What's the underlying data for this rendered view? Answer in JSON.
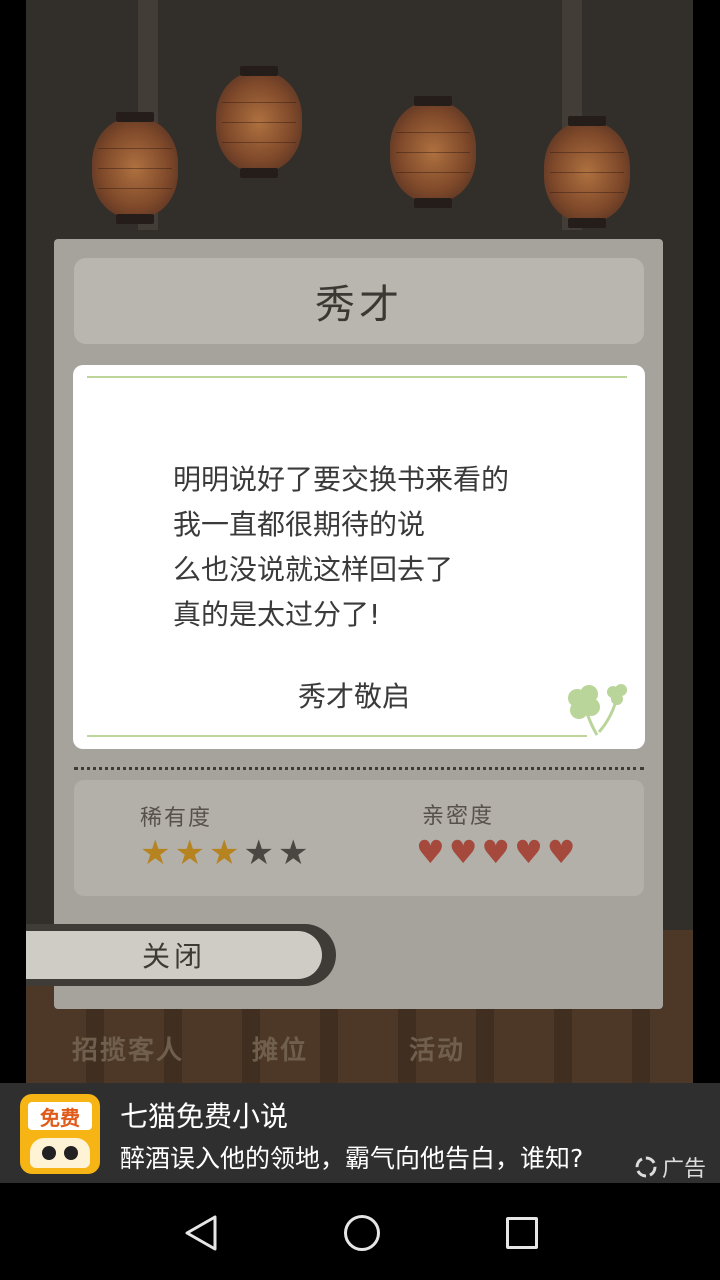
{
  "dialog": {
    "title": "秀才",
    "letter_lines": [
      "明明说好了要交换书来看的",
      "我一直都很期待的说",
      "么也没说就这样回去了",
      "真的是太过分了!"
    ],
    "signature": "秀才敬启",
    "rarity_label": "稀有度",
    "rarity_stars": 3,
    "rarity_max": 5,
    "intimacy_label": "亲密度",
    "intimacy_hearts": 5,
    "close_label": "关闭"
  },
  "background_nav": {
    "items": [
      "招揽客人",
      "摊位",
      "活动"
    ]
  },
  "ad": {
    "icon_text": "免费",
    "title": "七猫免费小说",
    "description": "醉酒误入他的领地，霸气向他告白，谁知?",
    "label": "广告"
  },
  "system_nav": {
    "icons": [
      "back-icon",
      "home-icon",
      "recent-apps-icon"
    ]
  },
  "colors": {
    "star_filled": "#b5831f",
    "star_empty": "#4a4742",
    "heart": "#a4493c",
    "accent_line": "#bdd49a"
  }
}
